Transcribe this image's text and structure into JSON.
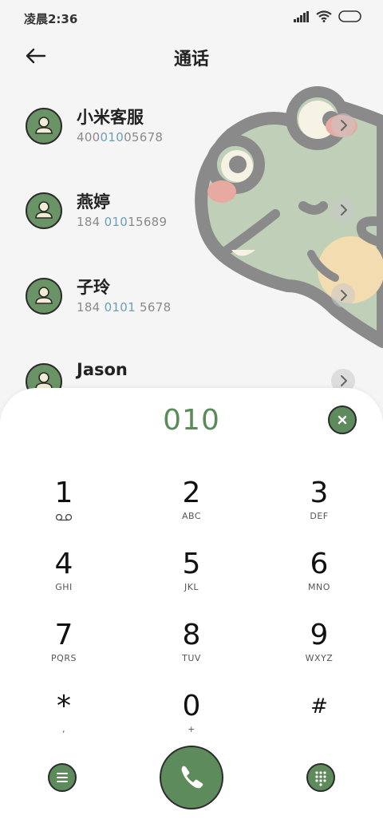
{
  "status": {
    "time": "凌晨2:36"
  },
  "header": {
    "title": "通话"
  },
  "contacts": [
    {
      "name": "小米客服",
      "num_pre": "400",
      "num_hl": "010",
      "num_post": "05678"
    },
    {
      "name": "燕婷",
      "num_pre": "184 ",
      "num_hl": "010",
      "num_post": "15689"
    },
    {
      "name": "子玲",
      "num_pre": "184 ",
      "num_hl": "0101",
      "num_post": " 5678"
    },
    {
      "name": "Jason",
      "num_pre": "",
      "num_hl": "",
      "num_post": ""
    }
  ],
  "dialer": {
    "number": "010",
    "keys": [
      {
        "digit": "1",
        "letters": ""
      },
      {
        "digit": "2",
        "letters": "ABC"
      },
      {
        "digit": "3",
        "letters": "DEF"
      },
      {
        "digit": "4",
        "letters": "GHI"
      },
      {
        "digit": "5",
        "letters": "JKL"
      },
      {
        "digit": "6",
        "letters": "MNO"
      },
      {
        "digit": "7",
        "letters": "PQRS"
      },
      {
        "digit": "8",
        "letters": "TUV"
      },
      {
        "digit": "9",
        "letters": "WXYZ"
      },
      {
        "digit": "*",
        "letters": ","
      },
      {
        "digit": "0",
        "letters": "+"
      },
      {
        "digit": "#",
        "letters": ""
      }
    ]
  },
  "icons": {
    "back": "back-arrow-icon",
    "clear": "close-icon",
    "menu": "menu-icon",
    "call": "phone-icon",
    "keypad": "keypad-icon",
    "voicemail": "voicemail-icon"
  },
  "colors": {
    "accent": "#5e8b5b",
    "highlight": "#6b9fb7",
    "background": "#f5f5f5"
  }
}
